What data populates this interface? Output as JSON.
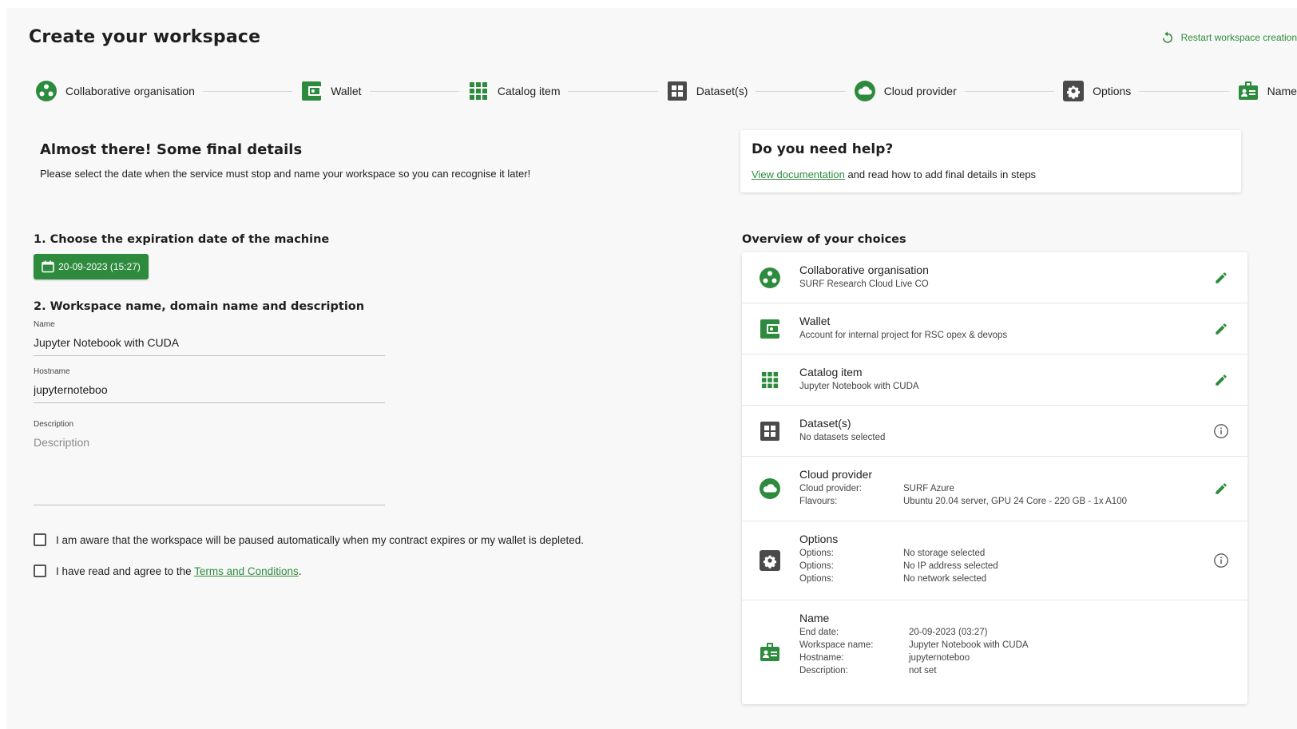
{
  "header": {
    "title": "Create your workspace",
    "restart_label": "Restart workspace creation"
  },
  "stepper": [
    {
      "label": "Collaborative organisation",
      "icon": "people-circle-icon"
    },
    {
      "label": "Wallet",
      "icon": "wallet-icon"
    },
    {
      "label": "Catalog item",
      "icon": "grid-icon"
    },
    {
      "label": "Dataset(s)",
      "icon": "dataset-icon"
    },
    {
      "label": "Cloud provider",
      "icon": "cloud-icon"
    },
    {
      "label": "Options",
      "icon": "gear-icon"
    },
    {
      "label": "Name",
      "icon": "id-badge-icon"
    }
  ],
  "intro": {
    "title": "Almost there! Some final details",
    "text": "Please select the date when the service must stop and name your workspace so you can recognise it later!"
  },
  "expiration": {
    "title": "1. Choose the expiration date of the machine",
    "date_label": "20-09-2023 (15:27)"
  },
  "naming": {
    "title": "2. Workspace name, domain name and description",
    "name_label": "Name",
    "name_value": "Jupyter Notebook with CUDA",
    "hostname_label": "Hostname",
    "hostname_value": "jupyternoteboo",
    "description_label": "Description",
    "description_placeholder": "Description"
  },
  "agreements": {
    "pause_text": "I am aware that the workspace will be paused automatically when my contract expires or my wallet is depleted.",
    "terms_prefix": "I have read and agree to the ",
    "terms_link": "Terms and Conditions",
    "terms_suffix": "."
  },
  "help": {
    "title": "Do you need help?",
    "link": "View documentation",
    "text": " and read how to add final details in steps"
  },
  "overview": {
    "title": "Overview of your choices",
    "collab": {
      "title": "Collaborative organisation",
      "sub": "SURF Research Cloud Live CO"
    },
    "wallet": {
      "title": "Wallet",
      "sub": "Account for internal project for RSC opex & devops"
    },
    "catalog": {
      "title": "Catalog item",
      "sub": "Jupyter Notebook with CUDA"
    },
    "datasets": {
      "title": "Dataset(s)",
      "sub": "No datasets selected"
    },
    "cloud": {
      "title": "Cloud provider",
      "k1": "Cloud provider:",
      "v1": "SURF Azure",
      "k2": "Flavours:",
      "v2": "Ubuntu 20.04 server, GPU 24 Core - 220 GB - 1x A100"
    },
    "options": {
      "title": "Options",
      "k1": "Options:",
      "v1": "No storage selected",
      "k2": "Options:",
      "v2": "No IP address selected",
      "k3": "Options:",
      "v3": "No network selected"
    },
    "name": {
      "title": "Name",
      "k1": "End date:",
      "v1": "20-09-2023 (03:27)",
      "k2": "Workspace name:",
      "v2": "Jupyter Notebook with CUDA",
      "k3": "Hostname:",
      "v3": "jupyternoteboo",
      "k4": "Description:",
      "v4": "not set"
    }
  },
  "colors": {
    "accent": "#2e8b3e",
    "dark_icon": "#4a4a4a"
  }
}
